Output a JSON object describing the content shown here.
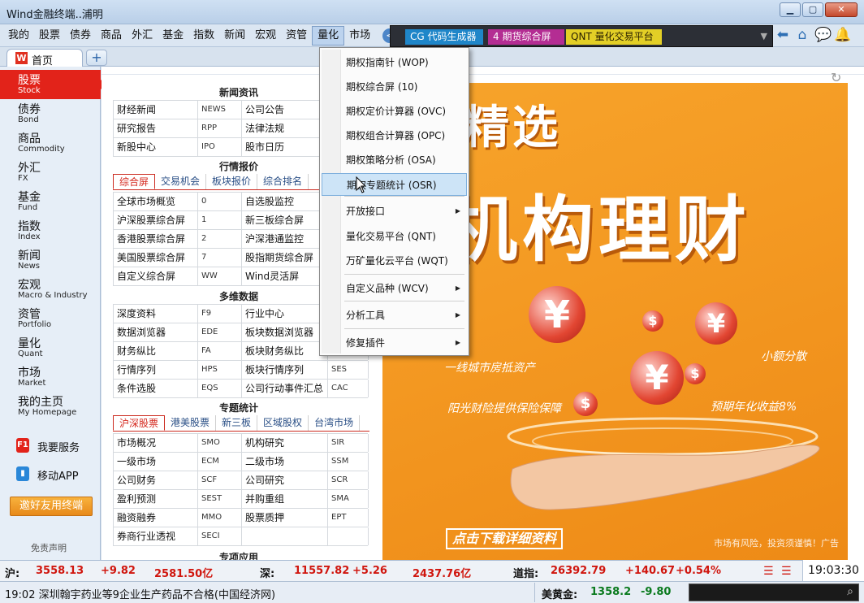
{
  "window": {
    "title": "Wind金融终端..浦明",
    "buttons": [
      "▁",
      "▢",
      "✕"
    ]
  },
  "menubar": {
    "items": [
      "我的",
      "股票",
      "债券",
      "商品",
      "外汇",
      "基金",
      "指数",
      "新闻",
      "宏观",
      "资管",
      "量化",
      "市场"
    ],
    "active": "量化",
    "quick": {
      "cg": "CG 代码生成器",
      "fut": "4 期货综合屏",
      "qnt": "QNT 量化交易平台"
    },
    "icons": [
      "arrow-left-icon",
      "home-icon",
      "chat-icon",
      "bell-icon"
    ]
  },
  "tabs": {
    "home": "首页",
    "home_logo": "W",
    "add": "+"
  },
  "sidebar": {
    "items": [
      {
        "cn": "股票",
        "en": "Stock"
      },
      {
        "cn": "债券",
        "en": "Bond"
      },
      {
        "cn": "商品",
        "en": "Commodity"
      },
      {
        "cn": "外汇",
        "en": "FX"
      },
      {
        "cn": "基金",
        "en": "Fund"
      },
      {
        "cn": "指数",
        "en": "Index"
      },
      {
        "cn": "新闻",
        "en": "News"
      },
      {
        "cn": "宏观",
        "en": "Macro & Industry"
      },
      {
        "cn": "资管",
        "en": "Portfolio"
      },
      {
        "cn": "量化",
        "en": "Quant"
      },
      {
        "cn": "市场",
        "en": "Market"
      },
      {
        "cn": "我的主页",
        "en": "My Homepage"
      }
    ],
    "services": [
      {
        "icon": "F1",
        "label": "我要服务"
      },
      {
        "icon": "▮",
        "label": "移动APP"
      }
    ],
    "invite": "邀好友用终端",
    "disclaimer": "免责声明"
  },
  "sections": {
    "news": {
      "title": "新闻资讯",
      "rows": [
        [
          "财经新闻",
          "NEWS",
          "公司公告",
          ""
        ],
        [
          "研究报告",
          "RPP",
          "法律法规",
          ""
        ],
        [
          "新股中心",
          "IPO",
          "股市日历",
          ""
        ]
      ]
    },
    "quotes": {
      "title": "行情报价",
      "tabs": [
        "综合屏",
        "交易机会",
        "板块报价",
        "综合排名"
      ],
      "rows": [
        [
          "全球市场概览",
          "0",
          "自选股监控",
          ""
        ],
        [
          "沪深股票综合屏",
          "1",
          "新三板综合屏",
          ""
        ],
        [
          "香港股票综合屏",
          "2",
          "沪深港通监控",
          ""
        ],
        [
          "美国股票综合屏",
          "7",
          "股指期货综合屏",
          ""
        ],
        [
          "自定义综合屏",
          "WW",
          "Wind灵活屏",
          ""
        ]
      ]
    },
    "data": {
      "title": "多维数据",
      "rows": [
        [
          "深度资料",
          "F9",
          "行业中心",
          ""
        ],
        [
          "数据浏览器",
          "EDE",
          "板块数据浏览器",
          ""
        ],
        [
          "财务纵比",
          "FA",
          "板块财务纵比",
          ""
        ],
        [
          "行情序列",
          "HPS",
          "板块行情序列",
          "SES"
        ],
        [
          "条件选股",
          "EQS",
          "公司行动事件汇总",
          "CAC"
        ]
      ]
    },
    "stats": {
      "title": "专题统计",
      "tabs": [
        "沪深股票",
        "港美股票",
        "新三板",
        "区域股权",
        "台湾市场"
      ],
      "rows": [
        [
          "市场概况",
          "SMO",
          "机构研究",
          "SIR"
        ],
        [
          "一级市场",
          "ECM",
          "二级市场",
          "SSM"
        ],
        [
          "公司财务",
          "SCF",
          "公司研究",
          "SCR"
        ],
        [
          "盈利预测",
          "SEST",
          "并购重组",
          "SMA"
        ],
        [
          "融资融券",
          "MMO",
          "股票质押",
          "EPT"
        ],
        [
          "券商行业透视",
          "SECI",
          "",
          ""
        ]
      ]
    },
    "apps": {
      "title": "专项应用"
    }
  },
  "dropdown": {
    "items": [
      {
        "label": "期权指南针 (WOP)",
        "sub": false
      },
      {
        "label": "期权综合屏 (10)",
        "sub": false
      },
      {
        "label": "期权定价计算器 (OVC)",
        "sub": false
      },
      {
        "label": "期权组合计算器 (OPC)",
        "sub": false
      },
      {
        "label": "期权策略分析 (OSA)",
        "sub": false
      },
      {
        "label": "期权专题统计 (OSR)",
        "sub": false
      },
      {
        "label": "开放接口",
        "sub": true
      },
      {
        "label": "量化交易平台 (QNT)",
        "sub": false
      },
      {
        "label": "万矿量化云平台 (WQT)",
        "sub": false
      },
      {
        "label": "自定义品种 (WCV)",
        "sub": true
      },
      {
        "label": "分析工具",
        "sub": true
      },
      {
        "label": "修复插件",
        "sub": true
      }
    ],
    "highlighted": 5
  },
  "banner": {
    "headline1": "万得精选",
    "headline2": "机构理财",
    "tag1": "一线城市房抵资产",
    "tag2": "阳光财险提供保险保障",
    "tag3": "小额分散",
    "tag4": "预期年化收益8%",
    "cta": "点击下载详细资料",
    "risk": "市场有风险，投资须谨慎！",
    "ad": "广告",
    "refresh": "↻"
  },
  "status": {
    "sh_label": "沪:",
    "sh_index": "3558.13",
    "sh_change": "+9.82",
    "sh_turnover": "2581.50亿",
    "sz_label": "深:",
    "sz_index": "11557.82",
    "sz_change": "+5.26",
    "sz_turnover": "2437.76亿",
    "dj_label": "道指:",
    "dj_index": "26392.79",
    "dj_change": "+140.67",
    "dj_pct": "+0.54%",
    "time": "19:03:30",
    "news": "19:02 深圳翰宇药业等9企业生产药品不合格(中国经济网)",
    "gold_label": "美黄金:",
    "gold_price": "1358.2",
    "gold_change": "-9.80"
  },
  "colors": {
    "up": "#d0160e",
    "down": "#0a7a1e",
    "accent": "#e2231a"
  }
}
